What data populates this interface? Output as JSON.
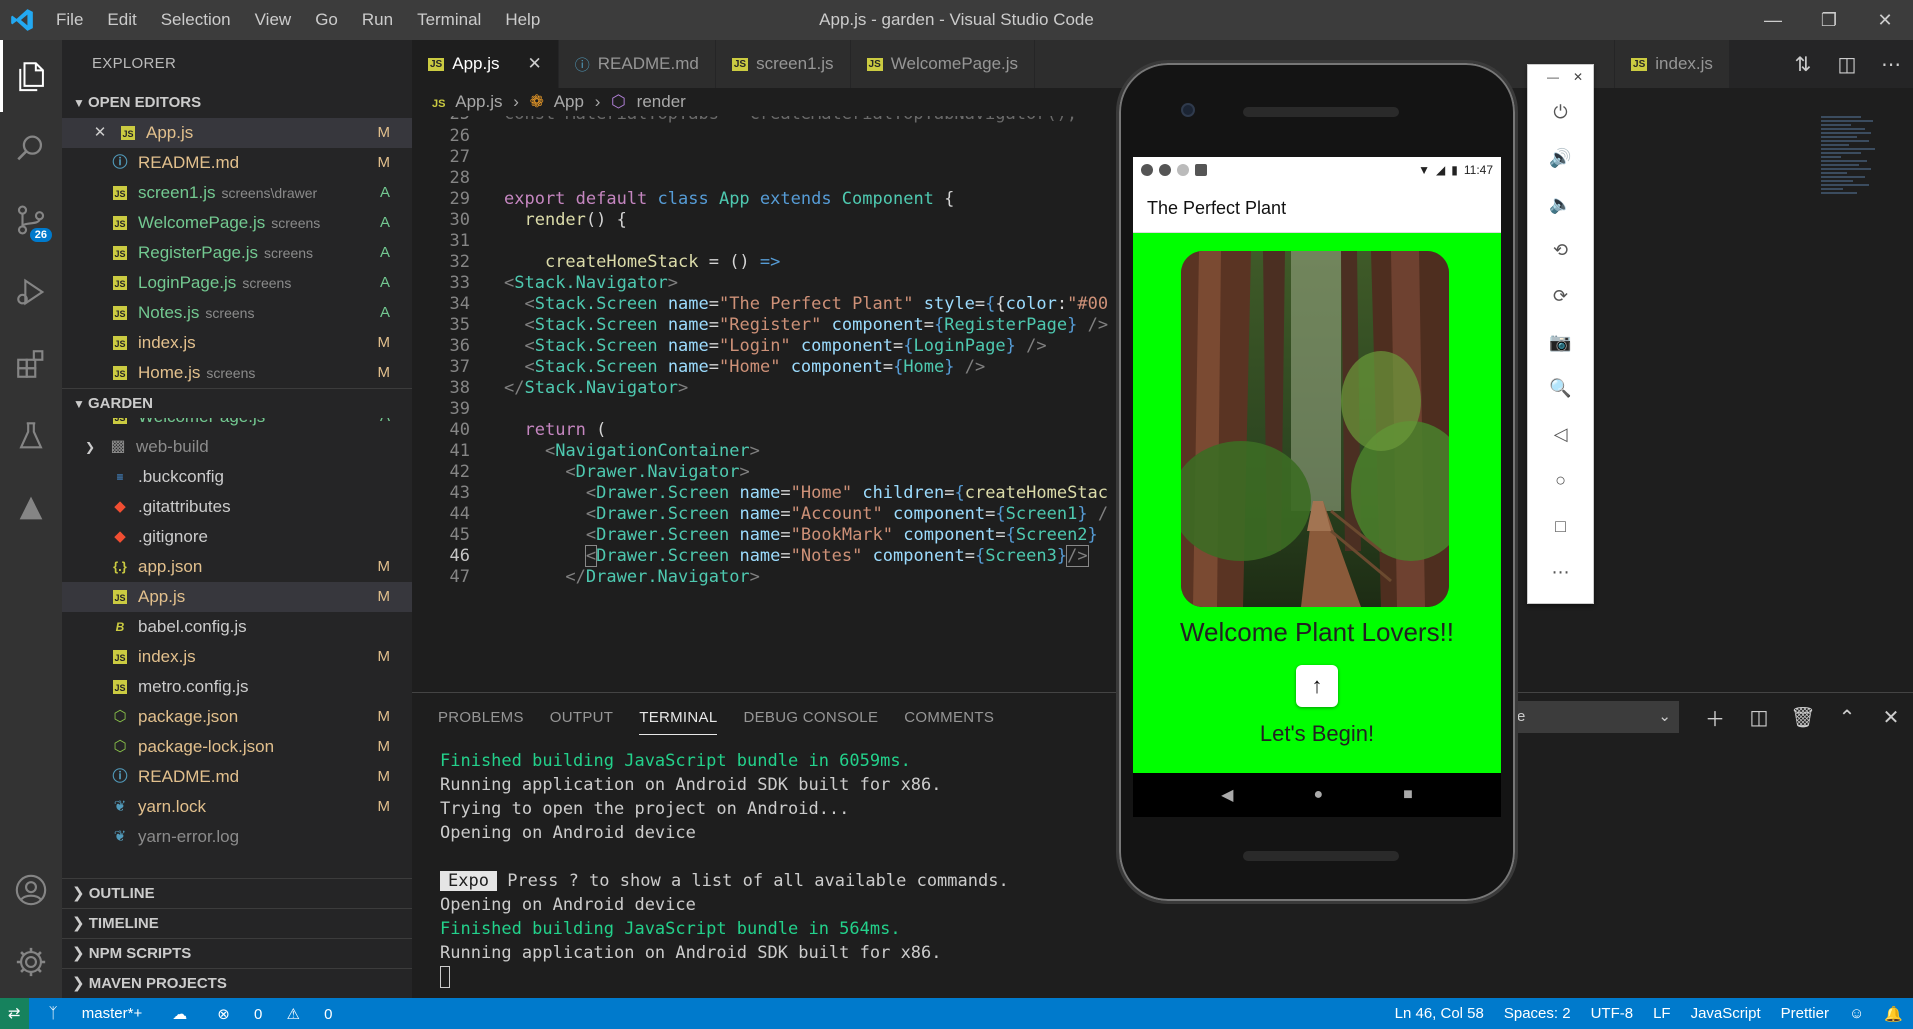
{
  "window": {
    "title": "App.js - garden - Visual Studio Code",
    "menu": [
      "File",
      "Edit",
      "Selection",
      "View",
      "Go",
      "Run",
      "Terminal",
      "Help"
    ]
  },
  "activity": {
    "scm_badge": "26"
  },
  "sidebar": {
    "header": "EXPLORER",
    "open_editors_title": "OPEN EDITORS",
    "open_editors": [
      {
        "name": "App.js",
        "dir": "",
        "status": "M",
        "type": "js"
      },
      {
        "name": "README.md",
        "dir": "",
        "status": "M",
        "type": "info"
      },
      {
        "name": "screen1.js",
        "dir": "screens\\drawer",
        "status": "A",
        "type": "js"
      },
      {
        "name": "WelcomePage.js",
        "dir": "screens",
        "status": "A",
        "type": "js"
      },
      {
        "name": "RegisterPage.js",
        "dir": "screens",
        "status": "A",
        "type": "js"
      },
      {
        "name": "LoginPage.js",
        "dir": "screens",
        "status": "A",
        "type": "js"
      },
      {
        "name": "Notes.js",
        "dir": "screens",
        "status": "A",
        "type": "js"
      },
      {
        "name": "index.js",
        "dir": "",
        "status": "M",
        "type": "js"
      },
      {
        "name": "Home.js",
        "dir": "screens",
        "status": "M",
        "type": "js"
      }
    ],
    "folder_title": "GARDEN",
    "folder_items": [
      {
        "name": "WelcomePage.js",
        "status": "A",
        "type": "js"
      },
      {
        "name": "web-build",
        "status": "",
        "type": "folder"
      },
      {
        "name": ".buckconfig",
        "status": "",
        "type": "buck"
      },
      {
        "name": ".gitattributes",
        "status": "",
        "type": "git"
      },
      {
        "name": ".gitignore",
        "status": "",
        "type": "git"
      },
      {
        "name": "app.json",
        "status": "M",
        "type": "json"
      },
      {
        "name": "App.js",
        "status": "M",
        "type": "js"
      },
      {
        "name": "babel.config.js",
        "status": "",
        "type": "babel"
      },
      {
        "name": "index.js",
        "status": "M",
        "type": "js"
      },
      {
        "name": "metro.config.js",
        "status": "",
        "type": "js"
      },
      {
        "name": "package.json",
        "status": "M",
        "type": "node"
      },
      {
        "name": "package-lock.json",
        "status": "M",
        "type": "node"
      },
      {
        "name": "README.md",
        "status": "M",
        "type": "info"
      },
      {
        "name": "yarn.lock",
        "status": "M",
        "type": "yarn"
      },
      {
        "name": "yarn-error.log",
        "status": "",
        "type": "yarn"
      }
    ],
    "bottom_sections": [
      "OUTLINE",
      "TIMELINE",
      "NPM SCRIPTS",
      "MAVEN PROJECTS"
    ]
  },
  "tabs": [
    "App.js",
    "README.md",
    "screen1.js",
    "WelcomePage.js",
    "index.js"
  ],
  "breadcrumb": [
    "App.js",
    "App",
    "render"
  ],
  "editor": {
    "lines": [
      {
        "n": "26",
        "code": ""
      },
      {
        "n": "27",
        "code": ""
      },
      {
        "n": "28",
        "code": ""
      },
      {
        "n": "29",
        "code": "export default class App extends Component {"
      },
      {
        "n": "30",
        "code": "  render() {"
      },
      {
        "n": "31",
        "code": ""
      },
      {
        "n": "32",
        "code": "    createHomeStack = () =>"
      },
      {
        "n": "33",
        "code": "<Stack.Navigator>"
      },
      {
        "n": "34",
        "code": "  <Stack.Screen name=\"The Perfect Plant\" style={{color:\"#00"
      },
      {
        "n": "35",
        "code": "  <Stack.Screen name=\"Register\" component={RegisterPage} />"
      },
      {
        "n": "36",
        "code": "  <Stack.Screen name=\"Login\" component={LoginPage} />"
      },
      {
        "n": "37",
        "code": "  <Stack.Screen name=\"Home\" component={Home} />"
      },
      {
        "n": "38",
        "code": "</Stack.Navigator>"
      },
      {
        "n": "39",
        "code": ""
      },
      {
        "n": "40",
        "code": "  return ("
      },
      {
        "n": "41",
        "code": "    <NavigationContainer>"
      },
      {
        "n": "42",
        "code": "      <Drawer.Navigator>"
      },
      {
        "n": "43",
        "code": "        <Drawer.Screen name=\"Home\" children={createHomeStac"
      },
      {
        "n": "44",
        "code": "        <Drawer.Screen name=\"Account\" component={Screen1} /"
      },
      {
        "n": "45",
        "code": "        <Drawer.Screen name=\"BookMark\" component={Screen2}"
      },
      {
        "n": "46",
        "code": "        <Drawer.Screen name=\"Notes\" component={Screen3}/>"
      },
      {
        "n": "47",
        "code": "      </Drawer.Navigator>"
      }
    ]
  },
  "panel": {
    "tabs": [
      "PROBLEMS",
      "OUTPUT",
      "TERMINAL",
      "DEBUG CONSOLE",
      "COMMENTS"
    ],
    "active_tab": "TERMINAL",
    "terminal_select": "e",
    "terminal": {
      "l1": "Finished building JavaScript bundle in 6059ms.",
      "l2": "Running application on Android SDK built for x86.",
      "l3": "Trying to open the project on Android...",
      "l4": "Opening on Android device",
      "expo_badge": "Expo",
      "l5": " Press ? to show a list of all available commands.",
      "l6": "Opening on Android device",
      "l7": "Finished building JavaScript bundle in 564ms.",
      "l8": "Running application on Android SDK built for x86."
    }
  },
  "status": {
    "branch": "master*+",
    "errors": "0",
    "warnings": "0",
    "position": "Ln 46, Col 58",
    "spaces": "Spaces: 2",
    "encoding": "UTF-8",
    "eol": "LF",
    "language": "JavaScript",
    "formatter": "Prettier"
  },
  "phone": {
    "time": "11:47",
    "app_title": "The Perfect Plant",
    "welcome": "Welcome Plant Lovers!!",
    "begin": "Let's Begin!",
    "background_color": "#00ff00"
  }
}
